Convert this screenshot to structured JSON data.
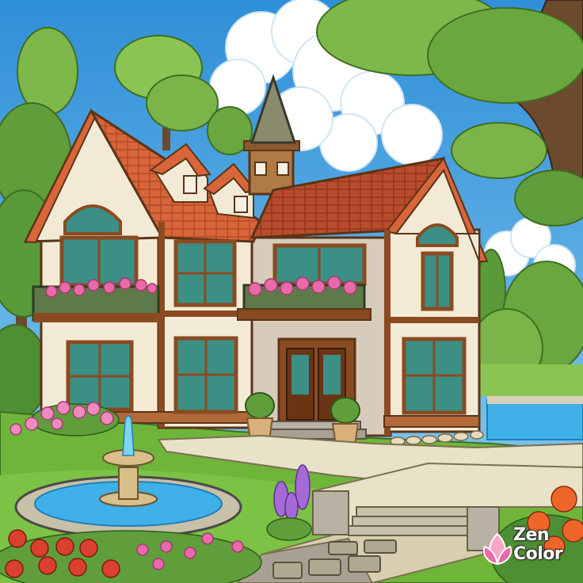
{
  "scene": {
    "subject": "house-with-garden-and-fountain",
    "style": "cartoon-illustration"
  },
  "colors": {
    "sky": "#4aa3e0",
    "roof": "#d9653a",
    "roof_dark": "#b5472a",
    "wall": "#f3ead6",
    "timber": "#8a4b22",
    "lawn": "#6fb53a",
    "water": "#3fb0e8",
    "tree": "#7fb84a",
    "flowers": "#e86aa8"
  },
  "logo": {
    "line1": "Zen",
    "line2": "Color"
  }
}
